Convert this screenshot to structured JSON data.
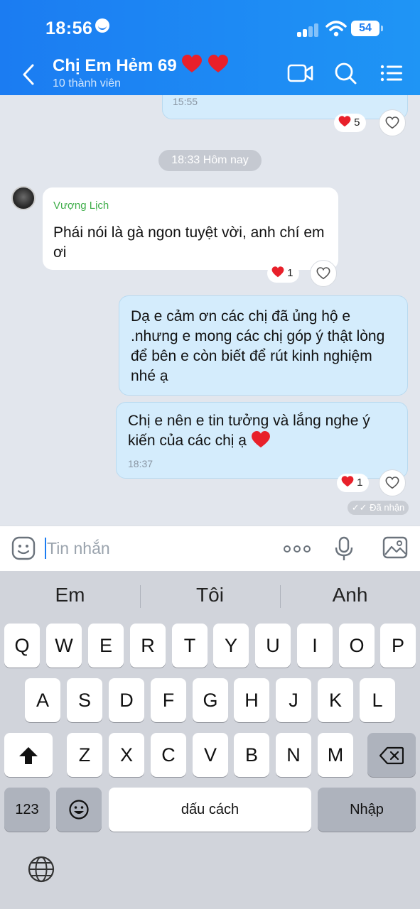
{
  "status_bar": {
    "time": "18:56",
    "battery": "54"
  },
  "header": {
    "title": "Chị Em Hẻm 69",
    "subtitle": "10 thành viên"
  },
  "chat": {
    "prev_message_time": "15:55",
    "prev_reaction_count": "5",
    "time_separator": "18:33 Hôm nay",
    "messages": [
      {
        "sender": "Vượng Lịch",
        "text": "Phái nói là gà ngon tuyệt vời, anh chí em ơi",
        "reaction_count": "1"
      },
      {
        "text": "Dạ e cảm ơn các chị đã ủng hộ e .nhưng e mong các chị góp ý thật lòng để bên e còn biết để rút kinh nghiệm nhé ạ"
      },
      {
        "text": "Chị e nên e tin tưởng và lắng nghe ý kiến của các chị ạ",
        "time": "18:37",
        "reaction_count": "1"
      }
    ],
    "delivery_status": "Đã nhận"
  },
  "composer": {
    "placeholder": "Tin nhắn"
  },
  "keyboard": {
    "suggestions": [
      "Em",
      "Tôi",
      "Anh"
    ],
    "row1": [
      "Q",
      "W",
      "E",
      "R",
      "T",
      "Y",
      "U",
      "I",
      "O",
      "P"
    ],
    "row2": [
      "A",
      "S",
      "D",
      "F",
      "G",
      "H",
      "J",
      "K",
      "L"
    ],
    "row3": [
      "Z",
      "X",
      "C",
      "V",
      "B",
      "N",
      "M"
    ],
    "numbers_key": "123",
    "space_key": "dấu cách",
    "return_key": "Nhập"
  },
  "colors": {
    "header": "#1b7cf2",
    "my_bubble": "#d4ecfc",
    "sender_name": "#3fae4a",
    "heart": "#e8202a"
  }
}
